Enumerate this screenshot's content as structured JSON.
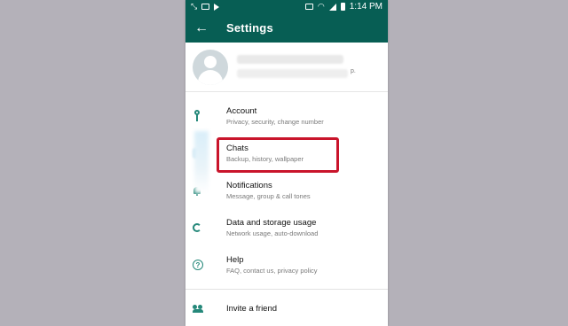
{
  "status_bar": {
    "time": "1:14 PM",
    "left_icons": [
      "missed-call-icon",
      "gallery-icon",
      "play-store-icon"
    ],
    "right_icons": [
      "vibrate-icon",
      "wifi-icon",
      "signal-icon",
      "battery-icon"
    ]
  },
  "toolbar": {
    "title": "Settings",
    "back_icon": "back-arrow-icon",
    "back_glyph": "←"
  },
  "profile": {
    "name_blurred": true,
    "status_suffix": "p."
  },
  "menu": {
    "items": [
      {
        "label": "Account",
        "sub": "Privacy, security, change number",
        "icon": "key-icon"
      },
      {
        "label": "Chats",
        "sub": "Backup, history, wallpaper",
        "icon": "chat-icon"
      },
      {
        "label": "Notifications",
        "sub": "Message, group & call tones",
        "icon": "bell-icon"
      },
      {
        "label": "Data and storage usage",
        "sub": "Network usage, auto-download",
        "icon": "data-usage-icon"
      },
      {
        "label": "Help",
        "sub": "FAQ, contact us, privacy policy",
        "icon": "help-icon"
      },
      {
        "label": "Invite a friend",
        "sub": "",
        "icon": "people-icon"
      }
    ]
  },
  "highlight": {
    "color": "#c9142b",
    "target": "Chats"
  },
  "colors": {
    "header": "#075e54",
    "accent": "#25887a",
    "background": "#b4b1b9"
  }
}
